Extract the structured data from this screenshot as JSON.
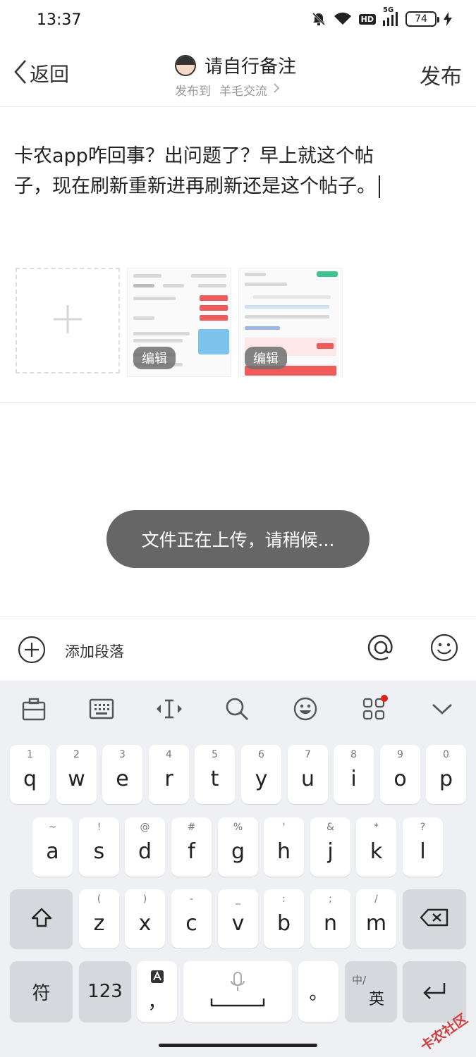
{
  "status_bar": {
    "time": "13:37",
    "battery": "74",
    "network": "5G",
    "hd": "HD"
  },
  "header": {
    "back_label": "返回",
    "title": "请自行备注",
    "publish_to_label": "发布到",
    "board_name": "羊毛交流",
    "publish_button": "发布"
  },
  "post": {
    "line1": "卡农app咋回事？出问题了？早上就这个帖",
    "line2": "子，现在刷新重新进再刷新还是这个帖子。"
  },
  "images": {
    "edit_label_1": "编辑",
    "edit_label_2": "编辑"
  },
  "toast": {
    "message": "文件正在上传，请稍候..."
  },
  "toolbar": {
    "add_paragraph": "添加段落"
  },
  "keyboard": {
    "row1": [
      {
        "main": "q",
        "sub": "1"
      },
      {
        "main": "w",
        "sub": "2"
      },
      {
        "main": "e",
        "sub": "3"
      },
      {
        "main": "r",
        "sub": "4"
      },
      {
        "main": "t",
        "sub": "5"
      },
      {
        "main": "y",
        "sub": "6"
      },
      {
        "main": "u",
        "sub": "7"
      },
      {
        "main": "i",
        "sub": "8"
      },
      {
        "main": "o",
        "sub": "9"
      },
      {
        "main": "p",
        "sub": "0"
      }
    ],
    "row2": [
      {
        "main": "a",
        "sub": "~"
      },
      {
        "main": "s",
        "sub": "!"
      },
      {
        "main": "d",
        "sub": "@"
      },
      {
        "main": "f",
        "sub": "#"
      },
      {
        "main": "g",
        "sub": "%"
      },
      {
        "main": "h",
        "sub": "'"
      },
      {
        "main": "j",
        "sub": "&"
      },
      {
        "main": "k",
        "sub": "*"
      },
      {
        "main": "l",
        "sub": "?"
      }
    ],
    "row3": [
      {
        "main": "z",
        "sub": "("
      },
      {
        "main": "x",
        "sub": ")"
      },
      {
        "main": "c",
        "sub": "-"
      },
      {
        "main": "v",
        "sub": "_"
      },
      {
        "main": "b",
        "sub": ":"
      },
      {
        "main": "n",
        "sub": ";"
      },
      {
        "main": "m",
        "sub": "/"
      }
    ],
    "symbol_key": "符",
    "number_key": "123",
    "comma_key": "，",
    "period_key": "。",
    "lang_key_main": "英",
    "lang_key_sub": "中/"
  },
  "watermark": "卡农社区"
}
